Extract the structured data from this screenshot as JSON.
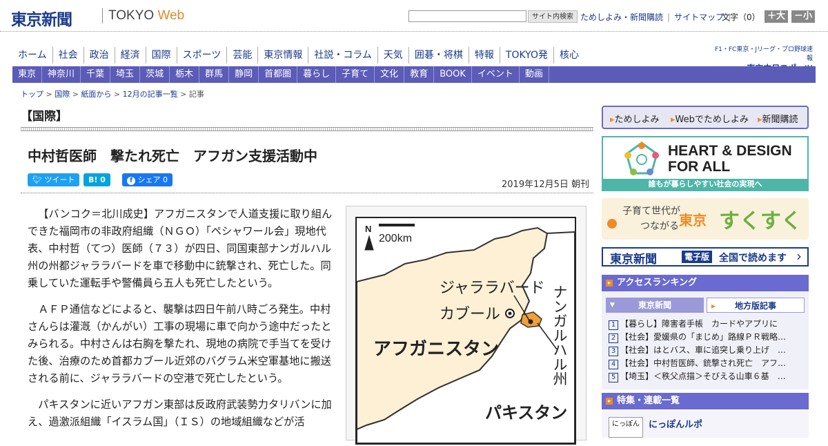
{
  "header": {
    "logo": "東京新聞",
    "logo_en_prefix": "TOKYO ",
    "logo_en_suffix": "Web",
    "search_button": "サイト内検索",
    "links": [
      "ためしよみ・新聞購読",
      "サイトマップ"
    ],
    "font_size_label": "文字（0）",
    "font_bigger": "＋大",
    "font_smaller": "－小"
  },
  "nav_main": [
    "ホーム",
    "社会",
    "政治",
    "経済",
    "国際",
    "スポーツ",
    "芸能",
    "東京情報",
    "社説・コラム",
    "天気",
    "囲碁・将棋",
    "特報",
    "TOKYO発",
    "核心"
  ],
  "chunichi": {
    "line1": "F1・FC東京・Jリーグ・プロ野球速報",
    "line2": "東京中日スポーツ"
  },
  "nav_region": [
    "東京",
    "神奈川",
    "千葉",
    "埼玉",
    "茨城",
    "栃木",
    "群馬",
    "静岡",
    "首都圏",
    "暮らし",
    "子育て",
    "文化",
    "教育",
    "BOOK",
    "イベント",
    "動画"
  ],
  "breadcrumb": [
    "トップ",
    "国際",
    "紙面から",
    "12月の記事一覧",
    "記事"
  ],
  "section": "【国際】",
  "article": {
    "headline": "中村哲医師　撃たれ死亡　アフガン支援活動中",
    "tweet": "ツイート",
    "hatena": "B! 0",
    "share": "シェア 0",
    "date": "2019年12月5日 朝刊",
    "paragraphs": [
      "【バンコク＝北川成史】アフガニスタンで人道支援に取り組んできた福岡市の非政府組織（ＮＧＯ）「ペシャワール会」現地代表、中村哲（てつ）医師（７３）が四日、同国東部ナンガルハル州の州都ジャララバードを車で移動中に銃撃され、死亡した。同乗していた運転手や警備員ら五人も死亡したという。",
      "ＡＦＰ通信などによると、襲撃は四日午前八時ごろ発生。中村さんらは灌漑（かんがい）工事の現場に車で向かう途中だったとみられる。中村さんは右胸を撃たれ、現地の病院で手当てを受けた後、治療のため首都カブール近郊のバグラム米空軍基地に搬送される前に、ジャララバードの空港で死亡したという。",
      "パキスタンに近いアフガン東部は反政府武装勢力タリバンに加え、過激派組織「イスラム国」（ＩＳ）の地域組織などが活"
    ]
  },
  "map": {
    "north": "N",
    "scale": "200km",
    "jalalabad": "ジャララバード",
    "kabul": "カブール",
    "province": "ナンガルハル州",
    "country": "アフガニスタン",
    "pakistan": "パキスタン"
  },
  "sidebar": {
    "tameshi": [
      "ためしよみ",
      "Webでためしよみ",
      "新聞購読"
    ],
    "hd_title1": "HEART & DESIGN",
    "hd_title2": "FOR ALL",
    "hd_sub": "誰もが暮らしやすい社会の実現へ",
    "sk_text1": "子育て世代が",
    "sk_text2": "つながる",
    "sk_brand1": "東京",
    "sk_brand2": "すくすく",
    "ed_logo": "東京新聞",
    "ed_badge": "電子版",
    "ed_text": "全国で読めます",
    "ranking_title": "アクセスランキング",
    "ranking_tabs": [
      "東京新聞",
      "地方版記事"
    ],
    "ranking": [
      {
        "n": "1",
        "t": "【暮らし】障害者手帳　カードやアプリに"
      },
      {
        "n": "2",
        "t": "【社会】愛媛県の「まじめ」路線ＰＲ戦略…"
      },
      {
        "n": "3",
        "t": "【社会】はとバス、車に追突し乗り上げ　…"
      },
      {
        "n": "4",
        "t": "【社会】中村哲医師、銃撃され死亡　アフ…"
      },
      {
        "n": "5",
        "t": "【埼玉】＜秩父点描＞そびえる山車６基　…"
      }
    ],
    "special_title": "特集・連載一覧",
    "special_item": "にっぽんルポ",
    "special_thumb": "にっぽん"
  },
  "colors": {
    "brand": "#1a3a8c",
    "nav_region_bg": "#5b5bb8",
    "accent_orange": "#f08a24",
    "map_land": "#fdf0d5",
    "map_highlight": "#f0a038"
  }
}
